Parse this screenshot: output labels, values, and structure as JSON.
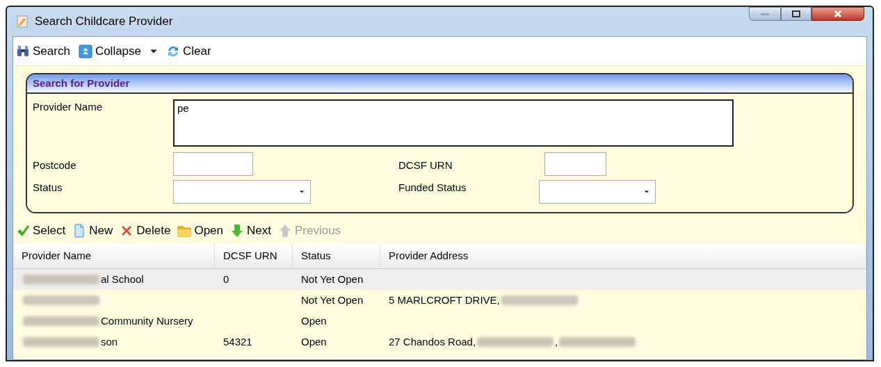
{
  "window": {
    "title": "Search Childcare Provider"
  },
  "toolbar": [
    {
      "kind": "search",
      "label": "Search",
      "dropdown": false
    },
    {
      "kind": "collapse",
      "label": "Collapse",
      "dropdown": true
    },
    {
      "kind": "clear",
      "label": "Clear",
      "dropdown": false
    }
  ],
  "search_panel": {
    "title": "Search for Provider",
    "provider_name": {
      "label": "Provider Name",
      "value": "pe"
    },
    "postcode": {
      "label": "Postcode"
    },
    "dcsf_urn": {
      "label": "DCSF URN"
    },
    "status": {
      "label": "Status"
    },
    "funded_status": {
      "label": "Funded Status"
    }
  },
  "actions": [
    {
      "kind": "select",
      "label": "Select",
      "disabled": false
    },
    {
      "kind": "new",
      "label": "New",
      "disabled": false
    },
    {
      "kind": "delete",
      "label": "Delete",
      "disabled": false
    },
    {
      "kind": "open",
      "label": "Open",
      "disabled": false
    },
    {
      "kind": "next",
      "label": "Next",
      "disabled": false
    },
    {
      "kind": "previous",
      "label": "Previous",
      "disabled": true
    }
  ],
  "table": {
    "columns": [
      "Provider Name",
      "DCSF URN",
      "Status",
      "Provider Address"
    ],
    "rows": [
      {
        "selected": true,
        "cells": [
          [
            {
              "kind": "blur"
            },
            {
              "kind": "text",
              "text": "al School"
            }
          ],
          [
            {
              "kind": "text",
              "text": "0"
            }
          ],
          [
            {
              "kind": "text",
              "text": "Not Yet Open"
            }
          ],
          []
        ]
      },
      {
        "selected": false,
        "cells": [
          [
            {
              "kind": "blur"
            }
          ],
          [],
          [
            {
              "kind": "text",
              "text": "Not Yet Open"
            }
          ],
          [
            {
              "kind": "text",
              "text": "5 MARLCROFT DRIVE,"
            },
            {
              "kind": "blur"
            }
          ]
        ]
      },
      {
        "selected": false,
        "cells": [
          [
            {
              "kind": "blur"
            },
            {
              "kind": "text",
              "text": "Community Nursery"
            }
          ],
          [],
          [
            {
              "kind": "text",
              "text": "Open"
            }
          ],
          []
        ]
      },
      {
        "selected": false,
        "cells": [
          [
            {
              "kind": "blur"
            },
            {
              "kind": "text",
              "text": "son"
            }
          ],
          [
            {
              "kind": "text",
              "text": "54321"
            }
          ],
          [
            {
              "kind": "text",
              "text": "Open"
            }
          ],
          [
            {
              "kind": "text",
              "text": "27 Chandos Road,"
            },
            {
              "kind": "blur"
            },
            {
              "kind": "text",
              "text": ","
            },
            {
              "kind": "blur"
            }
          ]
        ]
      }
    ]
  }
}
